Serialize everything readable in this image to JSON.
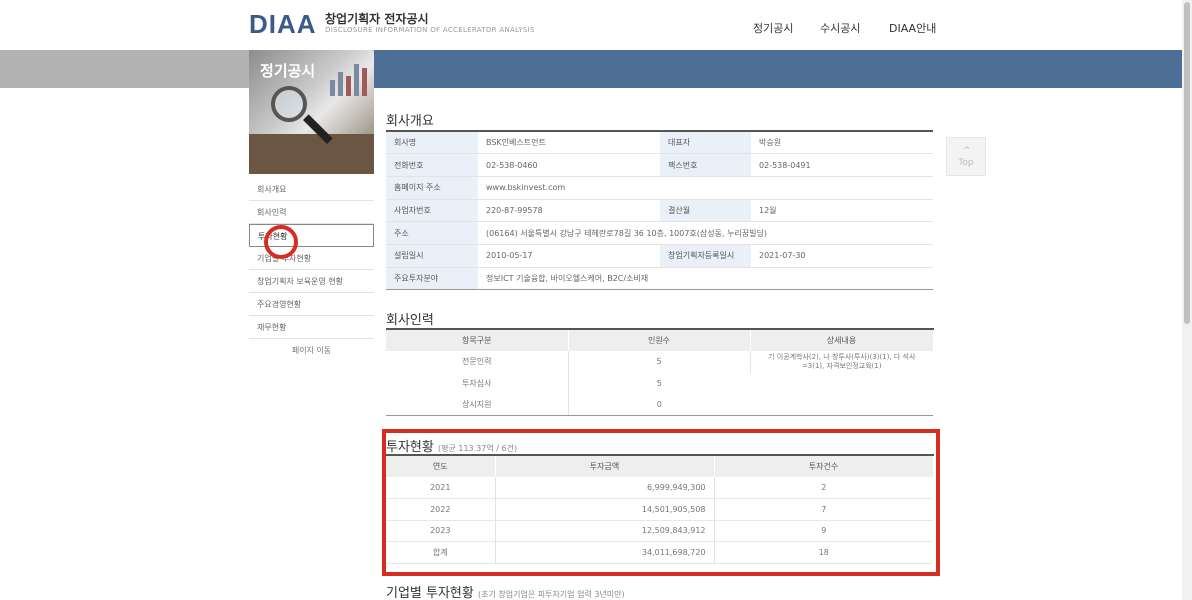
{
  "header": {
    "logo": "DIAA",
    "title": "창업기획자 전자공시",
    "subtitle": "DISCLOSURE INFORMATION OF ACCELERATOR ANALYSIS",
    "nav": [
      "정기공시",
      "수시공시",
      "DIAA안내"
    ]
  },
  "banner": {
    "title": "정기공시"
  },
  "sidebar": {
    "items": [
      "회사개요",
      "회사인력",
      "투자현황",
      "기업별 투자현황",
      "창업기획자 보육운영 현황",
      "주요경영현황",
      "재무현황"
    ],
    "active_index": 2,
    "more": "페이지 이동"
  },
  "overview": {
    "title": "회사개요",
    "rows": [
      [
        "회사명",
        "BSK인베스트먼트",
        "대표자",
        "박승원"
      ],
      [
        "전화번호",
        "02-538-0460",
        "팩스번호",
        "02-538-0491"
      ],
      [
        "홈페이지 주소",
        "www.bskinvest.com"
      ],
      [
        "사업자번호",
        "220-87-99578",
        "결산월",
        "12월"
      ],
      [
        "주소",
        "(06164) 서울특별시 강남구 테헤란로78길 36 10층, 1007호(삼성동, 누리꿈빌딩)"
      ],
      [
        "설립일시",
        "2010-05-17",
        "창업기획자등록일시",
        "2021-07-30"
      ],
      [
        "주요투자분야",
        "정보ICT 기술융합, 바이오헬스케어, B2C/소비재"
      ]
    ]
  },
  "staff": {
    "title": "회사인력",
    "headers": [
      "항목구분",
      "인원수",
      "상세내용"
    ],
    "rows": [
      [
        "전문인력",
        "5"
      ],
      [
        "투자심사",
        "5"
      ],
      [
        "상시지원",
        "0"
      ]
    ],
    "note": "기 이공계학사(2), 나 창투사(투사)(3)(1), 다 석사 =3(1), 자격보인정교육(1)"
  },
  "investment": {
    "title": "투자현황",
    "summary": "(평균 113.37억 / 6건)",
    "headers": [
      "연도",
      "투자금액",
      "투자건수"
    ],
    "rows": [
      [
        "2021",
        "6,999,949,300",
        "2"
      ],
      [
        "2022",
        "14,501,905,508",
        "7"
      ],
      [
        "2023",
        "12,509,843,912",
        "9"
      ],
      [
        "합계",
        "34,011,698,720",
        "18"
      ]
    ]
  },
  "company_invest": {
    "title": "기업별 투자현황",
    "note": "(초기 창업기업은 피투자기업 업력 3년미만)"
  },
  "top_button": {
    "label": "Top",
    "arrow": "^"
  }
}
